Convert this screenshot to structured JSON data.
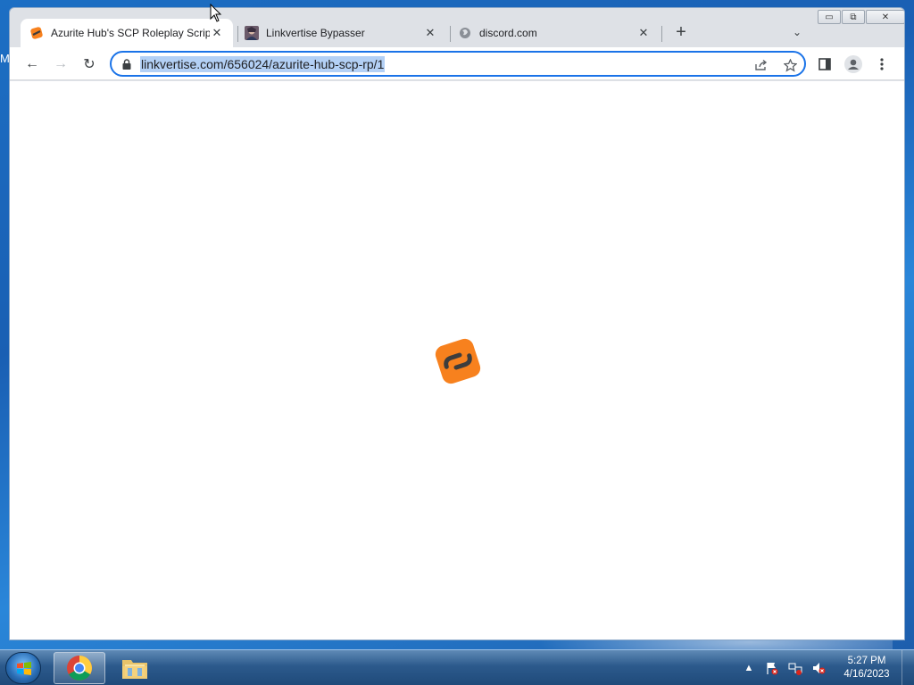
{
  "desktop": {
    "edge_letter": "M"
  },
  "window": {
    "controls": {
      "minimize": "▭",
      "restore": "⧉",
      "close": "✕"
    }
  },
  "tabs": [
    {
      "title": "Azurite Hub's SCP Roleplay Scrip",
      "close": "✕",
      "icon": "linkvertise-favicon"
    },
    {
      "title": "Linkvertise Bypasser",
      "close": "✕",
      "icon": "avatar-favicon"
    },
    {
      "title": "discord.com",
      "close": "✕",
      "icon": "globe-icon"
    }
  ],
  "toolbar": {
    "back": "←",
    "forward": "→",
    "reload": "↻",
    "url": "linkvertise.com/656024/azurite-hub-scp-rp/1",
    "new_tab": "+",
    "tab_list": "⌄"
  },
  "taskbar": {
    "clock_time": "5:27 PM",
    "clock_date": "4/16/2023",
    "tray_arrow": "▲"
  },
  "colors": {
    "accent": "#1a73e8",
    "url_selection": "#b3d0f5",
    "linkvertise_orange": "#f7811e",
    "linkvertise_dark": "#3d3d3d"
  }
}
